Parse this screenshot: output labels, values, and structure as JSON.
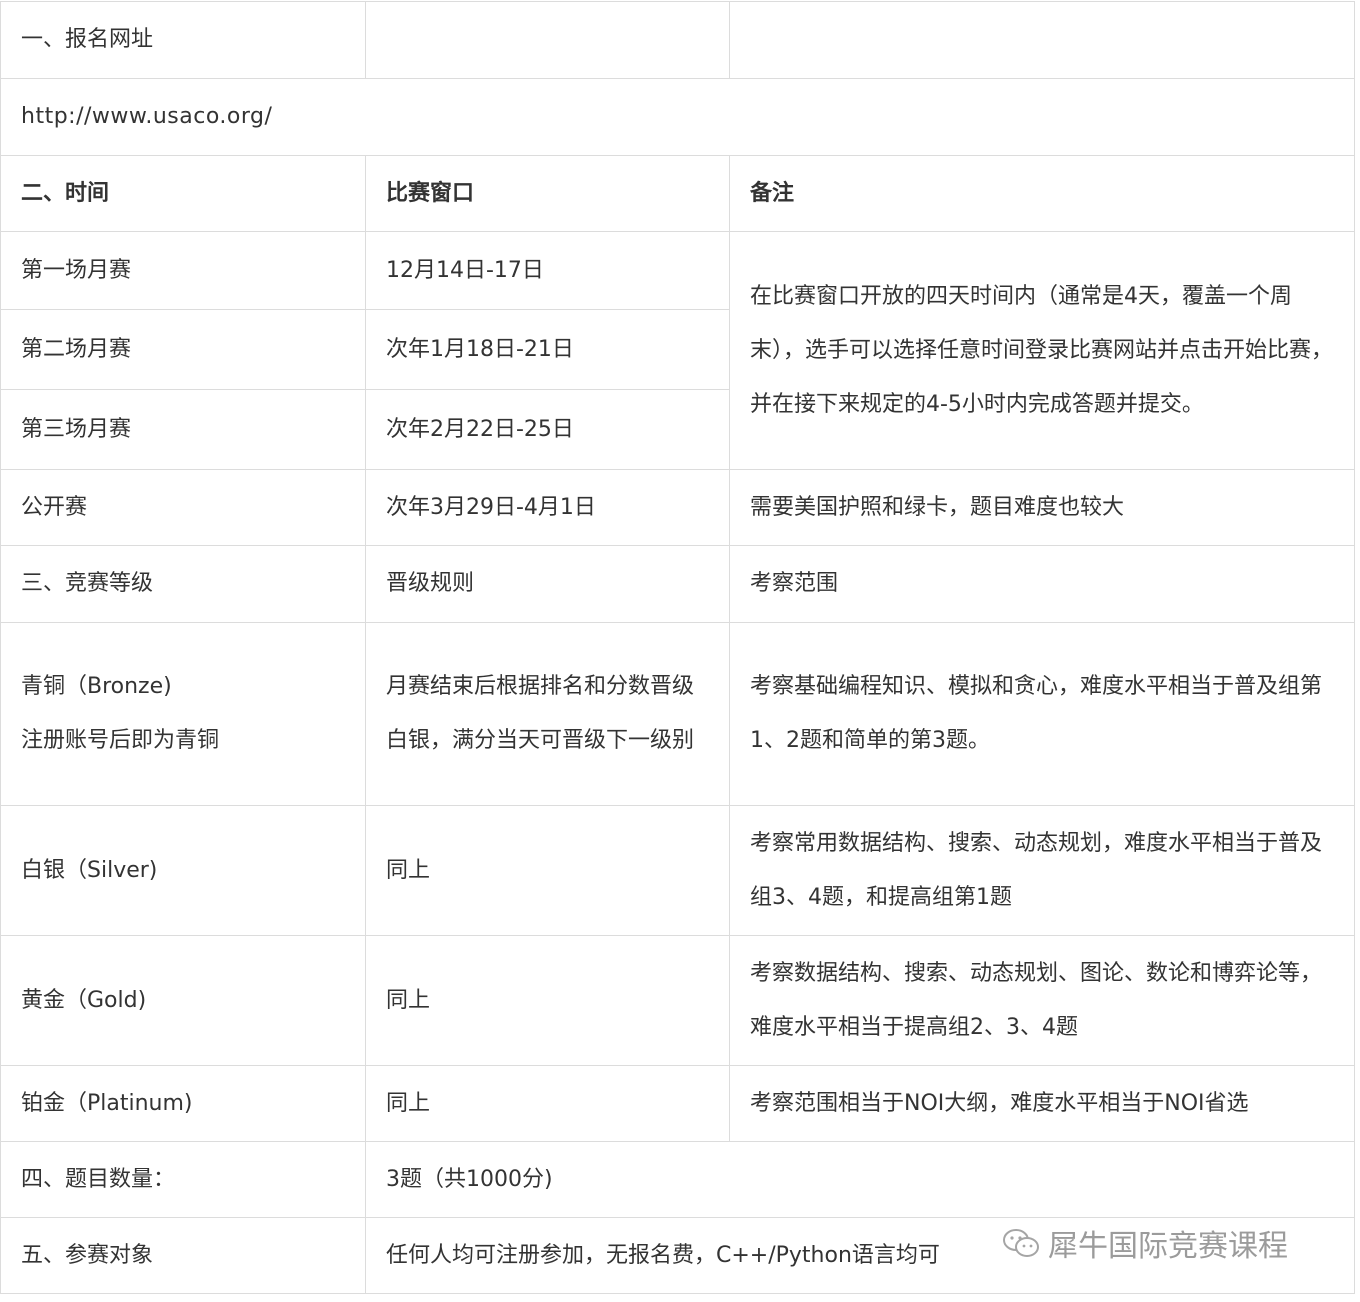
{
  "table": {
    "section1": {
      "label": "一、报名网址",
      "url": "http://www.usaco.org/"
    },
    "section2": {
      "label": "二、时间",
      "col2": "比赛窗口",
      "col3": "备注",
      "rows": [
        {
          "name": "第一场月赛",
          "date": "12月14日-17日"
        },
        {
          "name": "第二场月赛",
          "date": "次年1月18日-21日"
        },
        {
          "name": "第三场月赛",
          "date": "次年2月22日-25日"
        }
      ],
      "note": "在比赛窗口开放的四天时间内（通常是4天，覆盖一个周末），选手可以选择任意时间登录比赛网站并点击开始比赛，并在接下来规定的4-5小时内完成答题并提交。",
      "open": {
        "name": "公开赛",
        "date": "次年3月29日-4月1日",
        "note": "需要美国护照和绿卡，题目难度也较大"
      }
    },
    "section3": {
      "label": "三、竞赛等级",
      "col2": "晋级规则",
      "col3": "考察范围",
      "bronze": {
        "name": "青铜（Bronze)",
        "sub": "注册账号后即为青铜",
        "rule": "月赛结束后根据排名和分数晋级白银，满分当天可晋级下一级别",
        "scope": "考察基础编程知识、模拟和贪心，难度水平相当于普及组第1、2题和简单的第3题。"
      },
      "silver": {
        "name": "白银（Silver)",
        "rule": "同上",
        "scope": "考察常用数据结构、搜索、动态规划，难度水平相当于普及组3、4题，和提高组第1题"
      },
      "gold": {
        "name": "黄金（Gold)",
        "rule": "同上",
        "scope": "考察数据结构、搜索、动态规划、图论、数论和博弈论等，难度水平相当于提高组2、3、4题"
      },
      "platinum": {
        "name": "铂金（Platinum)",
        "rule": "同上",
        "scope": "考察范围相当于NOI大纲，难度水平相当于NOI省选"
      }
    },
    "section4": {
      "label": "四、题目数量：",
      "value": "3题（共1000分)"
    },
    "section5": {
      "label": "五、参赛对象",
      "value": "任何人均可注册参加，无报名费，C++/Python语言均可"
    }
  },
  "watermark": {
    "text": "犀牛国际竞赛课程",
    "icon": "wechat-icon"
  },
  "colors": {
    "border": "#dcdcdc",
    "text": "#333333"
  }
}
